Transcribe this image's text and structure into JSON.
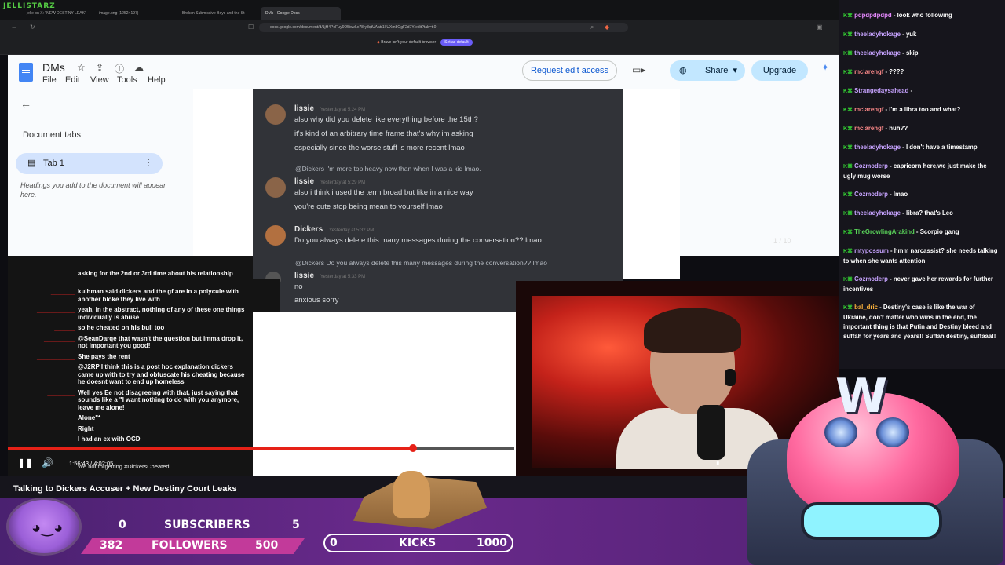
{
  "browser": {
    "brand": "JELLISTARZ",
    "tabs": [
      "jelle on X: \"NEW DESTINY LEAK\"",
      "image.png (1252×197)",
      "Broken Submissive Boys and the St",
      "DMs - Google Docs"
    ],
    "url": "docs.google.com/document/d/1jH4PoFuy6O5iwvLx78ry8qtUAatr1l-UXm8OgF2d7Y/edit?tab=t.0",
    "brave_notice": "Brave isn't your default browser",
    "brave_button": "Set as default"
  },
  "docs": {
    "title": "DMs",
    "menu": [
      "File",
      "Edit",
      "View",
      "Tools",
      "Help"
    ],
    "request_edit": "Request edit access",
    "share": "Share",
    "upgrade": "Upgrade",
    "document_tabs": "Document tabs",
    "tab1": "Tab 1",
    "hint": "Headings you add to the document will appear here."
  },
  "discord": {
    "m1_name": "lissie",
    "m1_time": "Yesterday at 5:24 PM",
    "m1_lines": [
      "also why did you delete like everything before the 15th?",
      "it's kind of an arbitrary time frame that's why im asking",
      "especially since the worse stuff is more recent lmao"
    ],
    "r1_reply": "@Dickers I'm more top heavy now than when I was a kid lmao.",
    "m2_name": "lissie",
    "m2_time": "Yesterday at 5:29 PM",
    "m2_lines": [
      "also i think i used the term broad but like in a nice way",
      "you're cute stop being mean to yourself lmao"
    ],
    "m3_name": "Dickers",
    "m3_time": "Yesterday at 5:32 PM",
    "m3_line": "Do you always delete this many messages during the conversation?? lmao",
    "r2_reply": "@Dickers Do you always delete this many messages during the conversation?? lmao",
    "m4_name": "lissie",
    "m4_time": "Yesterday at 5:33 PM",
    "m4_lines": [
      "no",
      "anxious sorry"
    ],
    "ghost": "1 / 10"
  },
  "player": {
    "chat": [
      {
        "u": "",
        "t": "asking for the 2nd or 3rd time about his relationship"
      },
      {
        "u": "_______",
        "t": "kuihman said dickers and the gf are in a polycule with another bloke they live with"
      },
      {
        "u": "___________",
        "t": "yeah, in the abstract, nothing of any of these one things individually is abuse"
      },
      {
        "u": "______",
        "t": "so he cheated on his bull too"
      },
      {
        "u": "_________",
        "t": "@SeanDarqe that wasn't the question but imma drop it, not important you good!"
      },
      {
        "u": "___________",
        "t": "She pays the rent"
      },
      {
        "u": "_____________",
        "t": "@J2RP I think this is a post hoc explanation dickers came up with to try and obfuscate his cheating because he doesnt want to end up homeless"
      },
      {
        "u": "________",
        "t": "Well yes Ee not disagreeing with that, just saying that sounds like a \"I want nothing to do with you anymore, leave me alone!"
      },
      {
        "u": "_________",
        "t": "Alone\"*"
      },
      {
        "u": "________",
        "t": "Right"
      },
      {
        "u": "",
        "t": "I had an ex with OCD"
      }
    ],
    "hashtag": "We not forgetting #DickersCheated",
    "progress": 0.8,
    "timecode": "1:56:43 / 4:02:05",
    "stream_title": "Talking to Dickers Accuser + New Destiny Court Leaks"
  },
  "twitch_chat": [
    {
      "name": "pdpdpdpdpd",
      "msg": "look who following",
      "c": "p"
    },
    {
      "name": "theeladyhokage",
      "msg": "yuk",
      "c": ""
    },
    {
      "name": "theeladyhokage",
      "msg": "skip",
      "c": ""
    },
    {
      "name": "mclarengf",
      "msg": "????",
      "c": "r"
    },
    {
      "name": "Strangedaysahead",
      "msg": "",
      "c": ""
    },
    {
      "name": "mclarengf",
      "msg": "I'm a libra too and what?",
      "c": "r"
    },
    {
      "name": "mclarengf",
      "msg": "huh??",
      "c": "r"
    },
    {
      "name": "theeladyhokage",
      "msg": "I don't have a timestamp",
      "c": ""
    },
    {
      "name": "Cozmoderp",
      "msg": "capricorn here,we just make the ugly mug worse",
      "c": ""
    },
    {
      "name": "Cozmoderp",
      "msg": "lmao",
      "c": ""
    },
    {
      "name": "theeladyhokage",
      "msg": "libra? that's Leo",
      "c": ""
    },
    {
      "name": "TheGrowlingArakind",
      "msg": "Scorpio gang",
      "c": "g"
    },
    {
      "name": "mtypossum",
      "msg": "hmm narcassist? she needs talking to when she wants attention",
      "c": ""
    },
    {
      "name": "Cozmoderp",
      "msg": "never gave her rewards for further incentives",
      "c": ""
    },
    {
      "name": "bal_dric",
      "msg": "Destiny's case is like the war of Ukraine, don't matter who wins in the end, the important thing is that Putin and Destiny bleed and suffah for years and years!! Suffah destiny, suffaaa!!",
      "c": "o"
    }
  ],
  "overlay": {
    "subs_current": "0",
    "subs_label": "SUBSCRIBERS",
    "subs_goal": "5",
    "followers_current": "382",
    "followers_label": "FOLLOWERS",
    "followers_goal": "500",
    "kicks_current": "0",
    "kicks_label": "KICKS",
    "kicks_goal": "1000",
    "mascot_letter": "W"
  },
  "colors": {
    "accent_red": "#e62117",
    "docs_blue": "#0b57d0",
    "overlay_purple": "#6a2a8c"
  }
}
